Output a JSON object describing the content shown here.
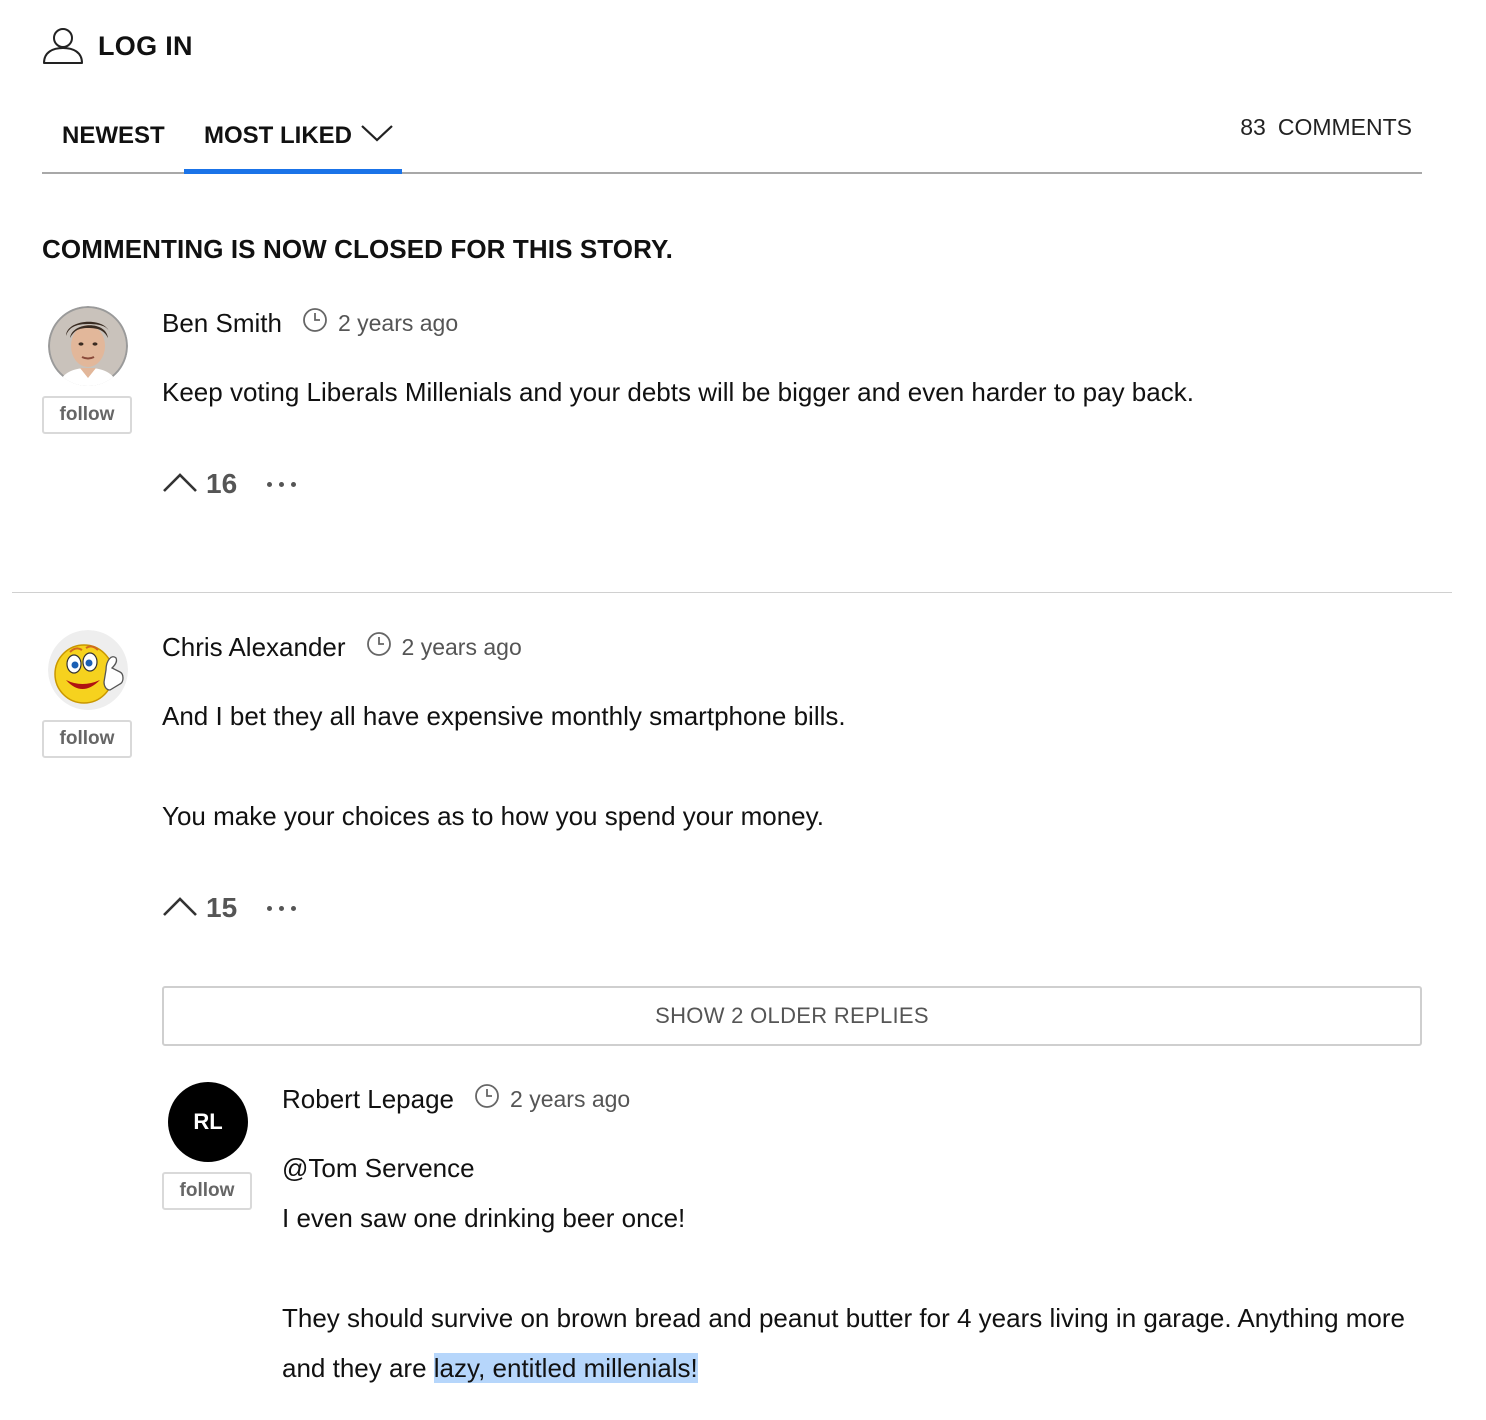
{
  "header": {
    "login_label": "LOG IN",
    "login_icon": "user-icon"
  },
  "tabs": {
    "newest": "NEWEST",
    "most_liked": "MOST LIKED",
    "active": "MOST LIKED",
    "accent_color": "#1a73e8"
  },
  "comment_count": {
    "number": "83",
    "label": "COMMENTS"
  },
  "notice": "COMMENTING IS NOW CLOSED FOR THIS STORY.",
  "comments": [
    {
      "author": "Ben Smith",
      "time": "2 years ago",
      "follow": "follow",
      "avatar": "photo",
      "body": [
        "Keep voting Liberals Millenials and your debts will be bigger and even harder to pay back."
      ],
      "votes": "16"
    },
    {
      "author": "Chris Alexander",
      "time": "2 years ago",
      "follow": "follow",
      "avatar": "smiley-thumbs-up",
      "body": [
        "And I bet they all have expensive monthly smartphone bills.",
        "You make your choices as to how you spend your money."
      ],
      "votes": "15",
      "show_older": "SHOW 2 OLDER REPLIES",
      "replies": [
        {
          "author": "Robert Lepage",
          "initials": "RL",
          "time": "2 years ago",
          "follow": "follow",
          "body": [
            "@Tom Servence",
            "I even saw one drinking beer once!"
          ],
          "body2_plain": "They should survive on brown bread and peanut butter for 4 years living in garage. Anything more and they are ",
          "body2_highlight": "lazy, entitled millenials!",
          "highlight_color": "#b6d6fb"
        }
      ]
    }
  ]
}
